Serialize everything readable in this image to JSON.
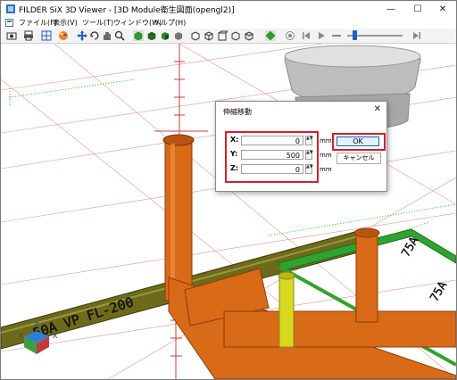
{
  "window": {
    "title": "FILDER SiX 3D Viewer - [3D Module衛生図面(opengl2)]"
  },
  "window_controls": {
    "minimize": "—",
    "maximize": "☐",
    "close": "✕"
  },
  "menu": [
    "ファイル(F)",
    "表示(V)",
    "ツール(T)",
    "ウィンドウ(W)",
    "ヘルプ(H)"
  ],
  "viewport": {
    "pipe_labels": {
      "main": "50A VP FL-200",
      "right_top": "75A",
      "right_side": "75A"
    },
    "axis": {
      "x": "X",
      "y": "Y",
      "z": "Z"
    }
  },
  "dialog": {
    "title": "伸縮移動",
    "close": "✕",
    "fields": [
      {
        "label": "X:",
        "value": "0",
        "unit": "mm"
      },
      {
        "label": "Y:",
        "value": "500",
        "unit": "mm"
      },
      {
        "label": "Z:",
        "value": "0",
        "unit": "mm"
      }
    ],
    "ok": "OK",
    "cancel": "キャンセル"
  },
  "colors": {
    "pipe_orange": "#d86a18",
    "pipe_olive": "#6d6a1a",
    "pipe_yellow": "#d8d820",
    "pipe_green": "#2fa32f",
    "grid_red": "#c83c3c",
    "highlight_red": "#d21f2a",
    "accent_blue": "#0a64d4"
  }
}
